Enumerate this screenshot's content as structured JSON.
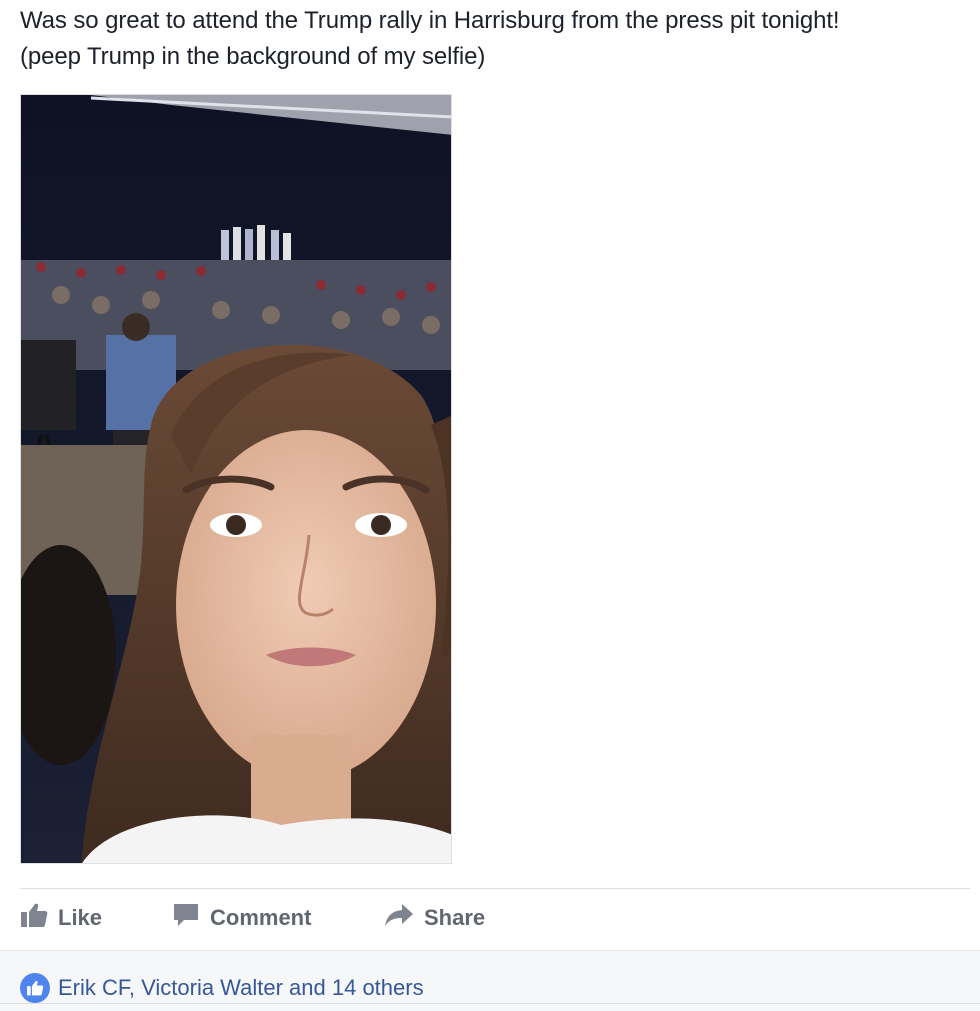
{
  "post": {
    "text_line1": "Was so great to attend the Trump rally in Harrisburg from the press pit tonight!",
    "text_line2": "(peep Trump in the background of my selfie)"
  },
  "actions": {
    "like_label": "Like",
    "comment_label": "Comment",
    "share_label": "Share"
  },
  "reactions": {
    "summary": "Erik CF, Victoria Walter and 14 others"
  },
  "colors": {
    "text": "#1d2129",
    "action_gray": "#606770",
    "link_blue": "#365899",
    "like_blue": "#4f83ed"
  },
  "icons": {
    "like": "thumbs-up-icon",
    "comment": "speech-bubble-icon",
    "share": "share-arrow-icon",
    "reaction": "like-reaction-icon"
  }
}
